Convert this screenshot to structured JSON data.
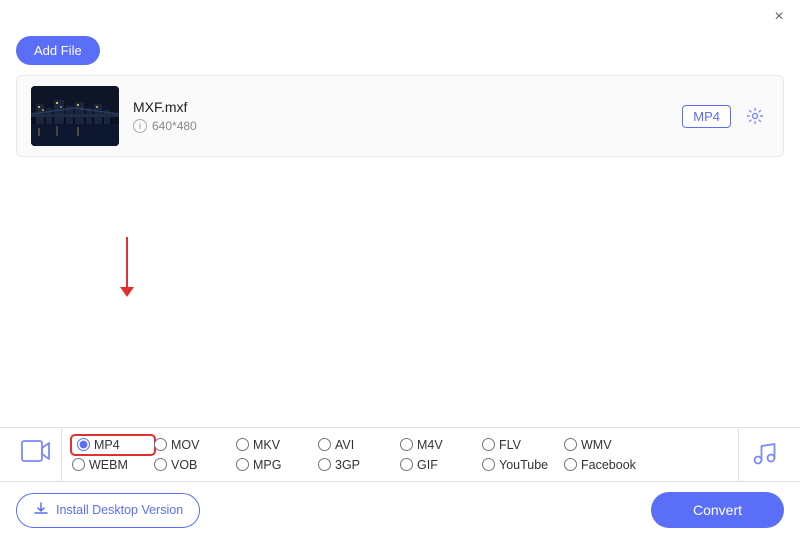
{
  "titlebar": {
    "close_label": "×"
  },
  "toolbar": {
    "add_file_label": "Add File"
  },
  "file": {
    "name": "MXF.mxf",
    "resolution": "640*480",
    "format": "MP4"
  },
  "formats": {
    "video_row1": [
      "MP4",
      "MOV",
      "MKV",
      "AVI",
      "M4V",
      "FLV",
      "WMV"
    ],
    "video_row2": [
      "WEBM",
      "VOB",
      "MPG",
      "3GP",
      "GIF",
      "YouTube",
      "Facebook"
    ],
    "selected": "MP4"
  },
  "actions": {
    "install_label": "Install Desktop Version",
    "convert_label": "Convert"
  }
}
